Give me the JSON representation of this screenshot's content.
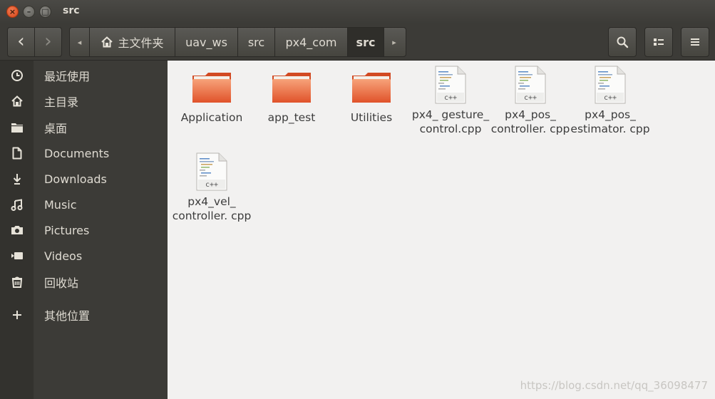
{
  "window": {
    "title": "src",
    "close_glyph": "×",
    "minimize_glyph": "–",
    "maximize_glyph": "□"
  },
  "toolbar": {
    "back_glyph": "‹",
    "forward_glyph": "›",
    "breadcrumb_left_arrow": "◂",
    "breadcrumb_right_arrow": "▸",
    "breadcrumbs": [
      "主文件夹",
      "uav_ws",
      "src",
      "px4_com",
      "src"
    ],
    "active_crumb_index": 4
  },
  "sidebar": {
    "items": [
      {
        "label": "最近使用",
        "icon": "clock-icon"
      },
      {
        "label": "主目录",
        "icon": "home-icon"
      },
      {
        "label": "桌面",
        "icon": "folder-icon"
      },
      {
        "label": "Documents",
        "icon": "document-icon"
      },
      {
        "label": "Downloads",
        "icon": "download-icon"
      },
      {
        "label": "Music",
        "icon": "music-icon"
      },
      {
        "label": "Pictures",
        "icon": "camera-icon"
      },
      {
        "label": "Videos",
        "icon": "video-icon"
      },
      {
        "label": "回收站",
        "icon": "trash-icon"
      },
      {
        "label": "其他位置",
        "icon": "plus-icon"
      }
    ]
  },
  "files": [
    {
      "name": "Application",
      "type": "folder"
    },
    {
      "name": "app_test",
      "type": "folder"
    },
    {
      "name": "Utilities",
      "type": "folder"
    },
    {
      "name": "px4_ gesture_ control.cpp",
      "type": "cpp"
    },
    {
      "name": "px4_pos_ controller. cpp",
      "type": "cpp"
    },
    {
      "name": "px4_pos_ estimator. cpp",
      "type": "cpp"
    },
    {
      "name": "px4_vel_ controller. cpp",
      "type": "cpp"
    }
  ],
  "file_icon_label": "c++",
  "watermark": "https://blog.csdn.net/qq_36098477",
  "colors": {
    "folder_top": "#f59a6f",
    "folder_bottom": "#e2542b",
    "sidebar_bg": "#3c3b37",
    "main_bg": "#f2f1f0"
  }
}
